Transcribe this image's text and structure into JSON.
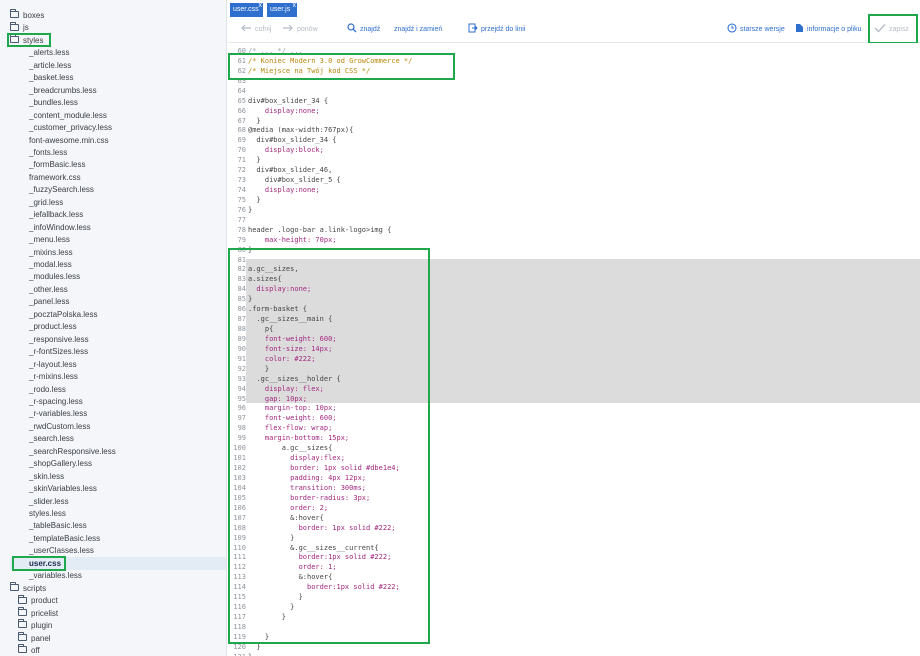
{
  "sidebar": {
    "tree": [
      {
        "label": "boxes",
        "type": "folder",
        "depth": 0
      },
      {
        "label": "js",
        "type": "folder",
        "depth": 0
      },
      {
        "label": "styles",
        "type": "folder",
        "depth": 0
      },
      {
        "label": "_alerts.less",
        "type": "file",
        "depth": 1
      },
      {
        "label": "_article.less",
        "type": "file",
        "depth": 1
      },
      {
        "label": "_basket.less",
        "type": "file",
        "depth": 1
      },
      {
        "label": "_breadcrumbs.less",
        "type": "file",
        "depth": 1
      },
      {
        "label": "_bundles.less",
        "type": "file",
        "depth": 1
      },
      {
        "label": "_content_module.less",
        "type": "file",
        "depth": 1
      },
      {
        "label": "_customer_privacy.less",
        "type": "file",
        "depth": 1
      },
      {
        "label": "font-awesome.min.css",
        "type": "file",
        "depth": 1
      },
      {
        "label": "_fonts.less",
        "type": "file",
        "depth": 1
      },
      {
        "label": "_formBasic.less",
        "type": "file",
        "depth": 1
      },
      {
        "label": "framework.css",
        "type": "file",
        "depth": 1
      },
      {
        "label": "_fuzzySearch.less",
        "type": "file",
        "depth": 1
      },
      {
        "label": "_grid.less",
        "type": "file",
        "depth": 1
      },
      {
        "label": "_iefallback.less",
        "type": "file",
        "depth": 1
      },
      {
        "label": "_infoWindow.less",
        "type": "file",
        "depth": 1
      },
      {
        "label": "_menu.less",
        "type": "file",
        "depth": 1
      },
      {
        "label": "_mixins.less",
        "type": "file",
        "depth": 1
      },
      {
        "label": "_modal.less",
        "type": "file",
        "depth": 1
      },
      {
        "label": "_modules.less",
        "type": "file",
        "depth": 1
      },
      {
        "label": "_other.less",
        "type": "file",
        "depth": 1
      },
      {
        "label": "_panel.less",
        "type": "file",
        "depth": 1
      },
      {
        "label": "_pocztaPolska.less",
        "type": "file",
        "depth": 1
      },
      {
        "label": "_product.less",
        "type": "file",
        "depth": 1
      },
      {
        "label": "_responsive.less",
        "type": "file",
        "depth": 1
      },
      {
        "label": "_r-fontSizes.less",
        "type": "file",
        "depth": 1
      },
      {
        "label": "_r-layout.less",
        "type": "file",
        "depth": 1
      },
      {
        "label": "_r-mixins.less",
        "type": "file",
        "depth": 1
      },
      {
        "label": "_rodo.less",
        "type": "file",
        "depth": 1
      },
      {
        "label": "_r-spacing.less",
        "type": "file",
        "depth": 1
      },
      {
        "label": "_r-variables.less",
        "type": "file",
        "depth": 1
      },
      {
        "label": "_rwdCustom.less",
        "type": "file",
        "depth": 1
      },
      {
        "label": "_search.less",
        "type": "file",
        "depth": 1
      },
      {
        "label": "_searchResponsive.less",
        "type": "file",
        "depth": 1
      },
      {
        "label": "_shopGallery.less",
        "type": "file",
        "depth": 1
      },
      {
        "label": "_skin.less",
        "type": "file",
        "depth": 1
      },
      {
        "label": "_skinVariables.less",
        "type": "file",
        "depth": 1
      },
      {
        "label": "_slider.less",
        "type": "file",
        "depth": 1
      },
      {
        "label": "styles.less",
        "type": "file",
        "depth": 1
      },
      {
        "label": "_tableBasic.less",
        "type": "file",
        "depth": 1
      },
      {
        "label": "_templateBasic.less",
        "type": "file",
        "depth": 1
      },
      {
        "label": "_userClasses.less",
        "type": "file",
        "depth": 1
      },
      {
        "label": "user.css",
        "type": "file",
        "depth": 1,
        "selected": true
      },
      {
        "label": "_variables.less",
        "type": "file",
        "depth": 1
      },
      {
        "label": "scripts",
        "type": "folder",
        "depth": 0
      },
      {
        "label": "product",
        "type": "folder",
        "depth": 1
      },
      {
        "label": "pricelist",
        "type": "folder",
        "depth": 1
      },
      {
        "label": "plugin",
        "type": "folder",
        "depth": 1
      },
      {
        "label": "panel",
        "type": "folder",
        "depth": 1
      },
      {
        "label": "off",
        "type": "folder",
        "depth": 1
      }
    ]
  },
  "tabs": [
    {
      "label": "user.css",
      "close": "x"
    },
    {
      "label": "user.js",
      "close": "x"
    }
  ],
  "toolbar": {
    "undo": "cofnij",
    "redo": "ponów",
    "find": "znajdź",
    "find_replace": "znajdź i zamień",
    "goto_line": "przejdź do linii",
    "older_versions": "starsze wersje",
    "file_info": "informacje o pliku",
    "save": "zapisz"
  },
  "editor": {
    "lines": [
      {
        "n": "60",
        "t": "/* ... */ ...",
        "c": "#9aa0a6"
      },
      {
        "n": "61",
        "t": "/* Koniec Modern 3.0 od GrowCommerce */",
        "c": "#b8860b"
      },
      {
        "n": "62",
        "t": "/* Miejsce na Twój kod CSS */",
        "c": "#b8860b"
      },
      {
        "n": "63",
        "t": "",
        "c": "#444"
      },
      {
        "n": "64",
        "t": "",
        "c": "#444"
      },
      {
        "n": "65",
        "t": "div#box_slider_34 {",
        "c": "#444"
      },
      {
        "n": "66",
        "t": "    display:none;",
        "c": "#a3277f"
      },
      {
        "n": "67",
        "t": "  }",
        "c": "#444"
      },
      {
        "n": "68",
        "t": "@media (max-width:767px){",
        "c": "#444"
      },
      {
        "n": "69",
        "t": "  div#box_slider_34 {",
        "c": "#444"
      },
      {
        "n": "70",
        "t": "    display:block;",
        "c": "#a3277f"
      },
      {
        "n": "71",
        "t": "  }",
        "c": "#444"
      },
      {
        "n": "72",
        "t": "  div#box_slider_46,",
        "c": "#444"
      },
      {
        "n": "73",
        "t": "    div#box_slider_5 {",
        "c": "#444"
      },
      {
        "n": "74",
        "t": "    display:none;",
        "c": "#a3277f"
      },
      {
        "n": "75",
        "t": "  }",
        "c": "#444"
      },
      {
        "n": "76",
        "t": "}",
        "c": "#444"
      },
      {
        "n": "77",
        "t": "",
        "c": "#444"
      },
      {
        "n": "78",
        "t": "header .logo-bar a.link-logo>img {",
        "c": "#444"
      },
      {
        "n": "79",
        "t": "    max-height: 70px;",
        "c": "#a3277f"
      },
      {
        "n": "80",
        "t": "}",
        "c": "#444"
      },
      {
        "n": "81",
        "t": "",
        "c": "#444"
      },
      {
        "n": "82",
        "t": "a.gc__sizes,",
        "c": "#444"
      },
      {
        "n": "83",
        "t": "a.sizes{",
        "c": "#444"
      },
      {
        "n": "84",
        "t": "  display:none;",
        "c": "#a3277f"
      },
      {
        "n": "85",
        "t": "}",
        "c": "#444"
      },
      {
        "n": "86",
        "t": ".form-basket {",
        "c": "#444"
      },
      {
        "n": "87",
        "t": "  .gc__sizes__main {",
        "c": "#444"
      },
      {
        "n": "88",
        "t": "    p{",
        "c": "#444"
      },
      {
        "n": "89",
        "t": "    font-weight: 600;",
        "c": "#a3277f"
      },
      {
        "n": "90",
        "t": "    font-size: 14px;",
        "c": "#a3277f"
      },
      {
        "n": "91",
        "t": "    color: #222;",
        "c": "#a3277f"
      },
      {
        "n": "92",
        "t": "    }",
        "c": "#444"
      },
      {
        "n": "93",
        "t": "  .gc__sizes__holder {",
        "c": "#444"
      },
      {
        "n": "94",
        "t": "    display: flex;",
        "c": "#a3277f"
      },
      {
        "n": "95",
        "t": "    gap: 10px;",
        "c": "#a3277f"
      },
      {
        "n": "96",
        "t": "    margin-top: 10px;",
        "c": "#a3277f"
      },
      {
        "n": "97",
        "t": "    font-weight: 600;",
        "c": "#a3277f"
      },
      {
        "n": "98",
        "t": "    flex-flow: wrap;",
        "c": "#a3277f"
      },
      {
        "n": "99",
        "t": "    margin-bottom: 15px;",
        "c": "#a3277f"
      },
      {
        "n": "100",
        "t": "        a.gc__sizes{",
        "c": "#444"
      },
      {
        "n": "101",
        "t": "          display:flex;",
        "c": "#a3277f"
      },
      {
        "n": "102",
        "t": "          border: 1px solid #dbe1e4;",
        "c": "#a3277f"
      },
      {
        "n": "103",
        "t": "          padding: 4px 12px;",
        "c": "#a3277f"
      },
      {
        "n": "104",
        "t": "          transition: 300ms;",
        "c": "#a3277f"
      },
      {
        "n": "105",
        "t": "          border-radius: 3px;",
        "c": "#a3277f"
      },
      {
        "n": "106",
        "t": "          order: 2;",
        "c": "#a3277f"
      },
      {
        "n": "107",
        "t": "          &:hover{",
        "c": "#444"
      },
      {
        "n": "108",
        "t": "            border: 1px solid #222;",
        "c": "#a3277f"
      },
      {
        "n": "109",
        "t": "          }",
        "c": "#444"
      },
      {
        "n": "110",
        "t": "          &.gc__sizes__current{",
        "c": "#444"
      },
      {
        "n": "111",
        "t": "            border:1px solid #222;",
        "c": "#a3277f"
      },
      {
        "n": "112",
        "t": "            order: 1;",
        "c": "#a3277f"
      },
      {
        "n": "113",
        "t": "            &:hover{",
        "c": "#444"
      },
      {
        "n": "114",
        "t": "              border:1px solid #222;",
        "c": "#a3277f"
      },
      {
        "n": "115",
        "t": "            }",
        "c": "#444"
      },
      {
        "n": "116",
        "t": "          }",
        "c": "#444"
      },
      {
        "n": "117",
        "t": "        }",
        "c": "#444"
      },
      {
        "n": "118",
        "t": "",
        "c": "#444"
      },
      {
        "n": "119",
        "t": "    }",
        "c": "#444"
      },
      {
        "n": "120",
        "t": "  }",
        "c": "#444"
      },
      {
        "n": "121",
        "t": "}",
        "c": "#444"
      },
      {
        "n": "122",
        "t": "",
        "c": "#444"
      }
    ]
  },
  "colors": {
    "accent": "#2f6fce",
    "highlight_box": "#1fa84b",
    "selection": "#dcdcdc"
  }
}
